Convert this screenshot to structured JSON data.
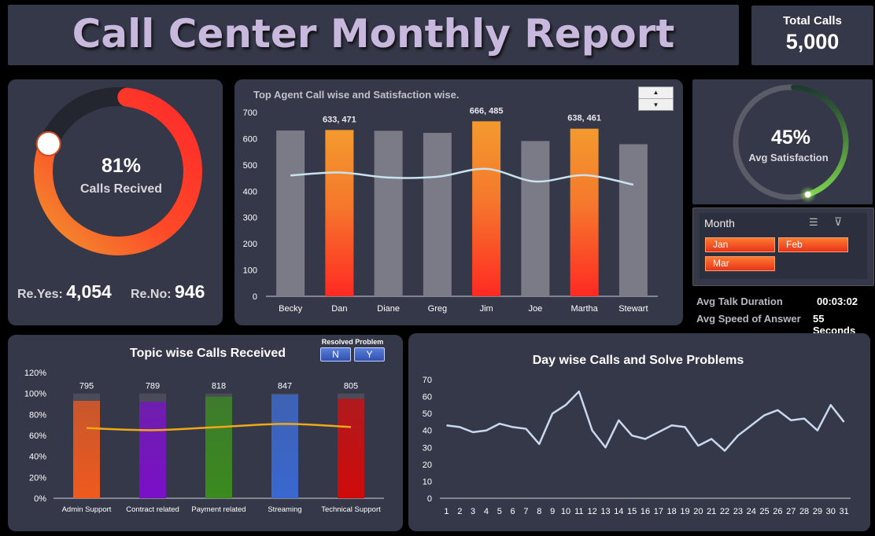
{
  "header": {
    "title": "Call Center Monthly Report",
    "total_calls_label": "Total Calls",
    "total_calls_value": "5,000"
  },
  "calls_received": {
    "percent_label": "81%",
    "percent": 0.81,
    "caption": "Calls Recived",
    "re_yes_label": "Re.Yes:",
    "re_yes_value": "4,054",
    "re_no_label": "Re.No:",
    "re_no_value": "946"
  },
  "satisfaction": {
    "percent_label": "45%",
    "percent": 0.45,
    "caption": "Avg Satisfaction"
  },
  "month_slicer": {
    "title": "Month",
    "items": [
      "Jan",
      "Feb",
      "Mar"
    ],
    "multi_select_icon": "multi-select-icon",
    "clear_filter_icon": "clear-filter-icon"
  },
  "stats": {
    "talk_label": "Avg Talk Duration",
    "talk_value": "00:03:02",
    "speed_label": "Avg Speed of Answer",
    "speed_value": "55 Seconds"
  },
  "colors": {
    "panel": "#353849",
    "accent_orange": "#f08a2c",
    "accent_red": "#ff2a2a",
    "bar_gray": "#7a7b86",
    "green": "#6cc94a"
  },
  "chart_data": [
    {
      "type": "bar",
      "title": "Top Agent Call wise and Satisfaction wise.",
      "categories": [
        "Becky",
        "Dan",
        "Diane",
        "Greg",
        "Jim",
        "Joe",
        "Martha",
        "Stewart"
      ],
      "series": [
        {
          "values": [
            631,
            633,
            630,
            622,
            666,
            591,
            638,
            579
          ]
        },
        {
          "values": [
            460,
            471,
            452,
            455,
            485,
            437,
            461,
            425
          ]
        }
      ],
      "highlighted": [
        "Dan",
        "Jim",
        "Martha"
      ],
      "data_labels": [
        "633, 471",
        "666, 485",
        "638, 461"
      ],
      "ylim": [
        0,
        700
      ],
      "yticks": [
        0,
        100,
        200,
        300,
        400,
        500,
        600,
        700
      ]
    },
    {
      "type": "bar",
      "title": "Topic wise Calls Received",
      "categories": [
        "Admin Support",
        "Contract related",
        "Payment related",
        "Streaming",
        "Technical Support"
      ],
      "series": [
        {
          "values": [
            795,
            789,
            818,
            847,
            805
          ]
        }
      ],
      "fill_percent": [
        0.93,
        0.92,
        0.97,
        0.99,
        0.95
      ],
      "line_percent": [
        0.67,
        0.65,
        0.68,
        0.71,
        0.68
      ],
      "bar_colors": [
        "#f05a1e",
        "#7a10c8",
        "#3a8a1e",
        "#3a68d0",
        "#d00a0a"
      ],
      "ylim": [
        0,
        1.2
      ],
      "ytick_labels": [
        "0%",
        "20%",
        "40%",
        "60%",
        "80%",
        "100%",
        "120%"
      ],
      "slicer_title": "Resolved Problem",
      "slicer_items": [
        "N",
        "Y"
      ]
    },
    {
      "type": "line",
      "title": "Day wise Calls and Solve Problems",
      "x": [
        1,
        2,
        3,
        4,
        5,
        6,
        7,
        8,
        9,
        10,
        11,
        12,
        13,
        14,
        15,
        16,
        17,
        18,
        19,
        20,
        21,
        22,
        23,
        24,
        25,
        26,
        27,
        28,
        29,
        30,
        31
      ],
      "values": [
        43,
        42,
        39,
        40,
        44,
        42,
        41,
        32,
        50,
        55,
        63,
        40,
        30,
        46,
        37,
        35,
        39,
        43,
        42,
        31,
        35,
        28,
        37,
        43,
        49,
        52,
        46,
        47,
        40,
        55,
        45
      ],
      "ylim": [
        0,
        70
      ],
      "yticks": [
        0,
        10,
        20,
        30,
        40,
        50,
        60,
        70
      ]
    }
  ]
}
